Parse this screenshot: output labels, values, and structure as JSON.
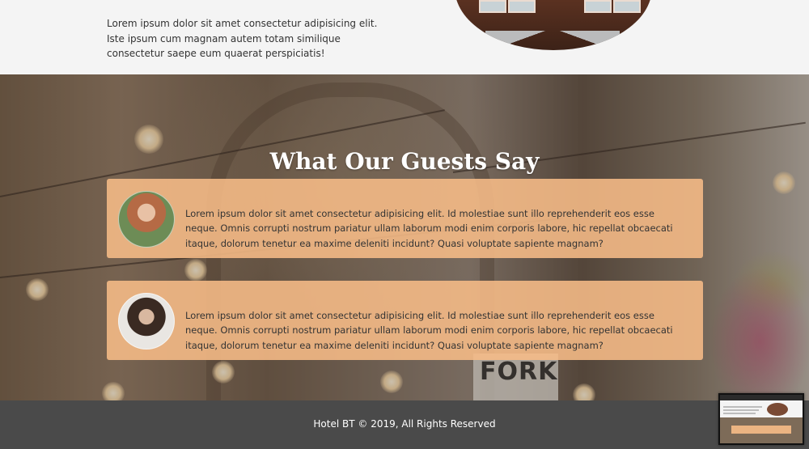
{
  "intro": {
    "text": "Lorem ipsum dolor sit amet consectetur adipisicing elit. Iste ipsum cum magnam autem totam similique consectetur saepe eum quaerat perspiciatis!"
  },
  "testimonials": {
    "title": "What Our Guests Say",
    "background_sign_text": "FORK",
    "items": [
      {
        "avatar": "woman-red-hair-avatar",
        "quote": "Lorem ipsum dolor sit amet consectetur adipisicing elit. Id molestiae sunt illo reprehenderit eos esse neque. Omnis corrupti nostrum pariatur ullam laborum modi enim corporis labore, hic repellat obcaecati itaque, dolorum tenetur ea maxime deleniti incidunt? Quasi voluptate sapiente magnam?"
      },
      {
        "avatar": "woman-dark-hair-avatar",
        "quote": "Lorem ipsum dolor sit amet consectetur adipisicing elit. Id molestiae sunt illo reprehenderit eos esse neque. Omnis corrupti nostrum pariatur ullam laborum modi enim corporis labore, hic repellat obcaecati itaque, dolorum tenetur ea maxime deleniti incidunt? Quasi voluptate sapiente magnam?"
      }
    ]
  },
  "footer": {
    "text": "Hotel BT © 2019, All Rights Reserved"
  },
  "colors": {
    "card_background": "#f7bc87",
    "footer_background": "#4a4a4a",
    "page_background": "#f4f4f4"
  }
}
